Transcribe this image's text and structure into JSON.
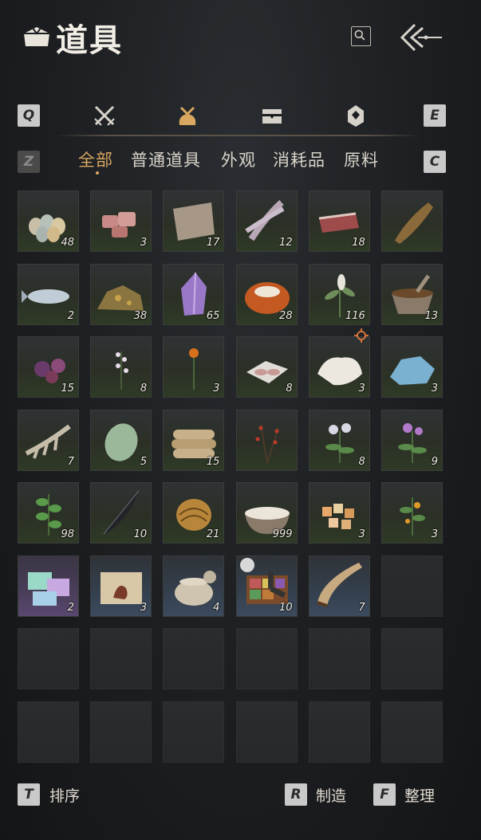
{
  "header": {
    "title": "道具",
    "title_icon": "inventory-bag-icon",
    "search_icon": "search-icon",
    "back_icon": "back-arrow-icon"
  },
  "category_bar": {
    "prev_key": "Q",
    "next_key": "E",
    "categories": [
      {
        "icon": "crossed-swords-icon",
        "active": false
      },
      {
        "icon": "pouch-icon",
        "active": true
      },
      {
        "icon": "chest-icon",
        "active": false
      },
      {
        "icon": "pendant-icon",
        "active": false
      }
    ],
    "accent_color": "#d9a760"
  },
  "subtabs": {
    "prev_key": "Z",
    "next_key": "C",
    "items": [
      {
        "label": "全部",
        "active": true
      },
      {
        "label": "普通道具",
        "active": false
      },
      {
        "label": "外观",
        "active": false
      },
      {
        "label": "消耗品",
        "active": false
      },
      {
        "label": "原料",
        "active": false
      }
    ]
  },
  "items": [
    {
      "name": "eggs",
      "count": "48",
      "rarity": "common"
    },
    {
      "name": "raw-meat",
      "count": "3",
      "rarity": "common"
    },
    {
      "name": "animal-hide",
      "count": "17",
      "rarity": "common"
    },
    {
      "name": "intestines",
      "count": "12",
      "rarity": "common"
    },
    {
      "name": "steak",
      "count": "18",
      "rarity": "common"
    },
    {
      "name": "carp-fish",
      "count": "",
      "rarity": "common"
    },
    {
      "name": "salmon-fish",
      "count": "2",
      "rarity": "common"
    },
    {
      "name": "ore-rock",
      "count": "38",
      "rarity": "common"
    },
    {
      "name": "amethyst-crystal",
      "count": "65",
      "rarity": "common"
    },
    {
      "name": "amber-stone",
      "count": "28",
      "rarity": "common"
    },
    {
      "name": "white-herb",
      "count": "116",
      "rarity": "common"
    },
    {
      "name": "mortar-spices",
      "count": "13",
      "rarity": "common"
    },
    {
      "name": "purple-flower",
      "count": "15",
      "rarity": "common"
    },
    {
      "name": "white-blossom",
      "count": "8",
      "rarity": "common"
    },
    {
      "name": "orange-lily",
      "count": "3",
      "rarity": "common"
    },
    {
      "name": "sliced-meat",
      "count": "8",
      "rarity": "common"
    },
    {
      "name": "white-fur",
      "count": "3",
      "rarity": "common",
      "marked": true
    },
    {
      "name": "blue-crystal",
      "count": "3",
      "rarity": "common"
    },
    {
      "name": "bone-ribs",
      "count": "7",
      "rarity": "common"
    },
    {
      "name": "melon",
      "count": "5",
      "rarity": "common"
    },
    {
      "name": "rice-sacks",
      "count": "15",
      "rarity": "common"
    },
    {
      "name": "red-berry-bush",
      "count": "",
      "rarity": "common"
    },
    {
      "name": "white-flower-plant",
      "count": "8",
      "rarity": "common"
    },
    {
      "name": "purple-flower-plant",
      "count": "9",
      "rarity": "common"
    },
    {
      "name": "green-herb",
      "count": "98",
      "rarity": "common"
    },
    {
      "name": "black-feather",
      "count": "10",
      "rarity": "common"
    },
    {
      "name": "golden-shell",
      "count": "21",
      "rarity": "common"
    },
    {
      "name": "milk-bowl",
      "count": "999",
      "rarity": "common"
    },
    {
      "name": "fruit-chunks",
      "count": "3",
      "rarity": "common"
    },
    {
      "name": "orange-fruit-plant",
      "count": "3",
      "rarity": "common"
    },
    {
      "name": "pastel-gift-box",
      "count": "2",
      "rarity": "rare"
    },
    {
      "name": "painting-scroll",
      "count": "3",
      "rarity": "uncommon"
    },
    {
      "name": "clay-jar",
      "count": "4",
      "rarity": "uncommon"
    },
    {
      "name": "spice-box",
      "count": "10",
      "rarity": "uncommon",
      "timed": true
    },
    {
      "name": "horn",
      "count": "7",
      "rarity": "uncommon"
    }
  ],
  "grid": {
    "columns": 6,
    "total_slots": 48
  },
  "footer": {
    "sort_key": "T",
    "sort_label": "排序",
    "craft_key": "R",
    "craft_label": "制造",
    "arrange_key": "F",
    "arrange_label": "整理"
  }
}
